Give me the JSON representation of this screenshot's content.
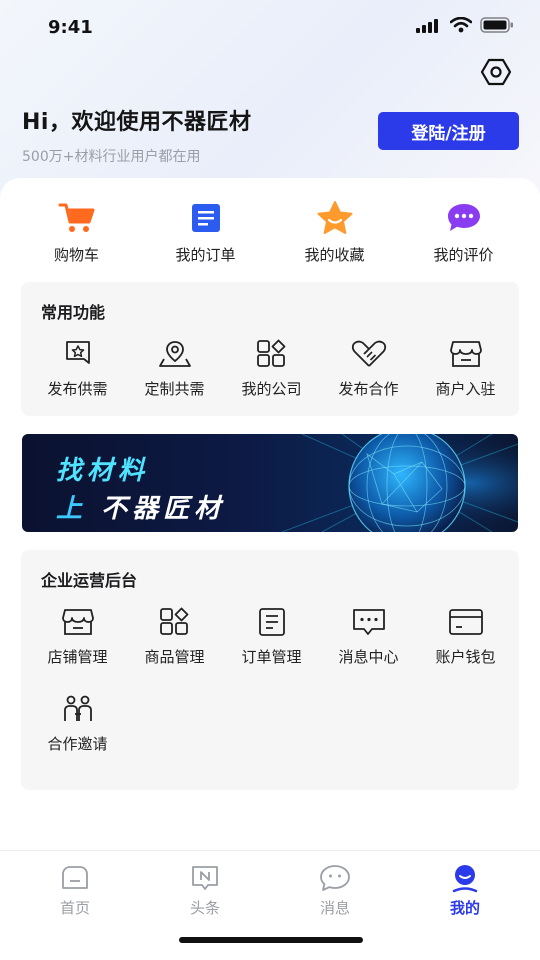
{
  "status_bar": {
    "time": "9:41"
  },
  "header": {
    "greeting": "Hi，欢迎使用不器匠材",
    "subtitle": "500万+材料行业用户都在用",
    "login_button": "登陆/注册",
    "settings_icon": "settings-hexagon-icon"
  },
  "quick_actions": [
    {
      "label": "购物车",
      "icon": "cart-icon",
      "color": "#ff6a1f"
    },
    {
      "label": "我的订单",
      "icon": "order-list-icon",
      "color": "#2c5bf0"
    },
    {
      "label": "我的收藏",
      "icon": "star-icon",
      "color": "#ff9a2c"
    },
    {
      "label": "我的评价",
      "icon": "comment-icon",
      "color": "#8a3cf0"
    }
  ],
  "common_functions": {
    "title": "常用功能",
    "items": [
      {
        "label": "发布供需",
        "icon": "publish-supply-icon"
      },
      {
        "label": "定制共需",
        "icon": "location-pin-icon"
      },
      {
        "label": "我的公司",
        "icon": "company-grid-icon"
      },
      {
        "label": "发布合作",
        "icon": "handshake-icon"
      },
      {
        "label": "商户入驻",
        "icon": "store-icon"
      }
    ]
  },
  "banner": {
    "line1": "找材料",
    "line2_accent": "上",
    "line2_rest": "不器匠材"
  },
  "enterprise_backend": {
    "title": "企业运营后台",
    "items": [
      {
        "label": "店铺管理",
        "icon": "shop-icon"
      },
      {
        "label": "商品管理",
        "icon": "goods-grid-icon"
      },
      {
        "label": "订单管理",
        "icon": "order-doc-icon"
      },
      {
        "label": "消息中心",
        "icon": "message-icon"
      },
      {
        "label": "账户钱包",
        "icon": "wallet-icon"
      },
      {
        "label": "合作邀请",
        "icon": "invite-people-icon"
      }
    ]
  },
  "tabbar": {
    "tabs": [
      {
        "label": "首页",
        "icon": "home-icon",
        "active": false
      },
      {
        "label": "头条",
        "icon": "news-icon",
        "active": false
      },
      {
        "label": "消息",
        "icon": "chat-icon",
        "active": false
      },
      {
        "label": "我的",
        "icon": "profile-icon",
        "active": true
      }
    ]
  },
  "colors": {
    "accent": "#2c3bea",
    "inactive_tab": "#9a9ea6"
  }
}
